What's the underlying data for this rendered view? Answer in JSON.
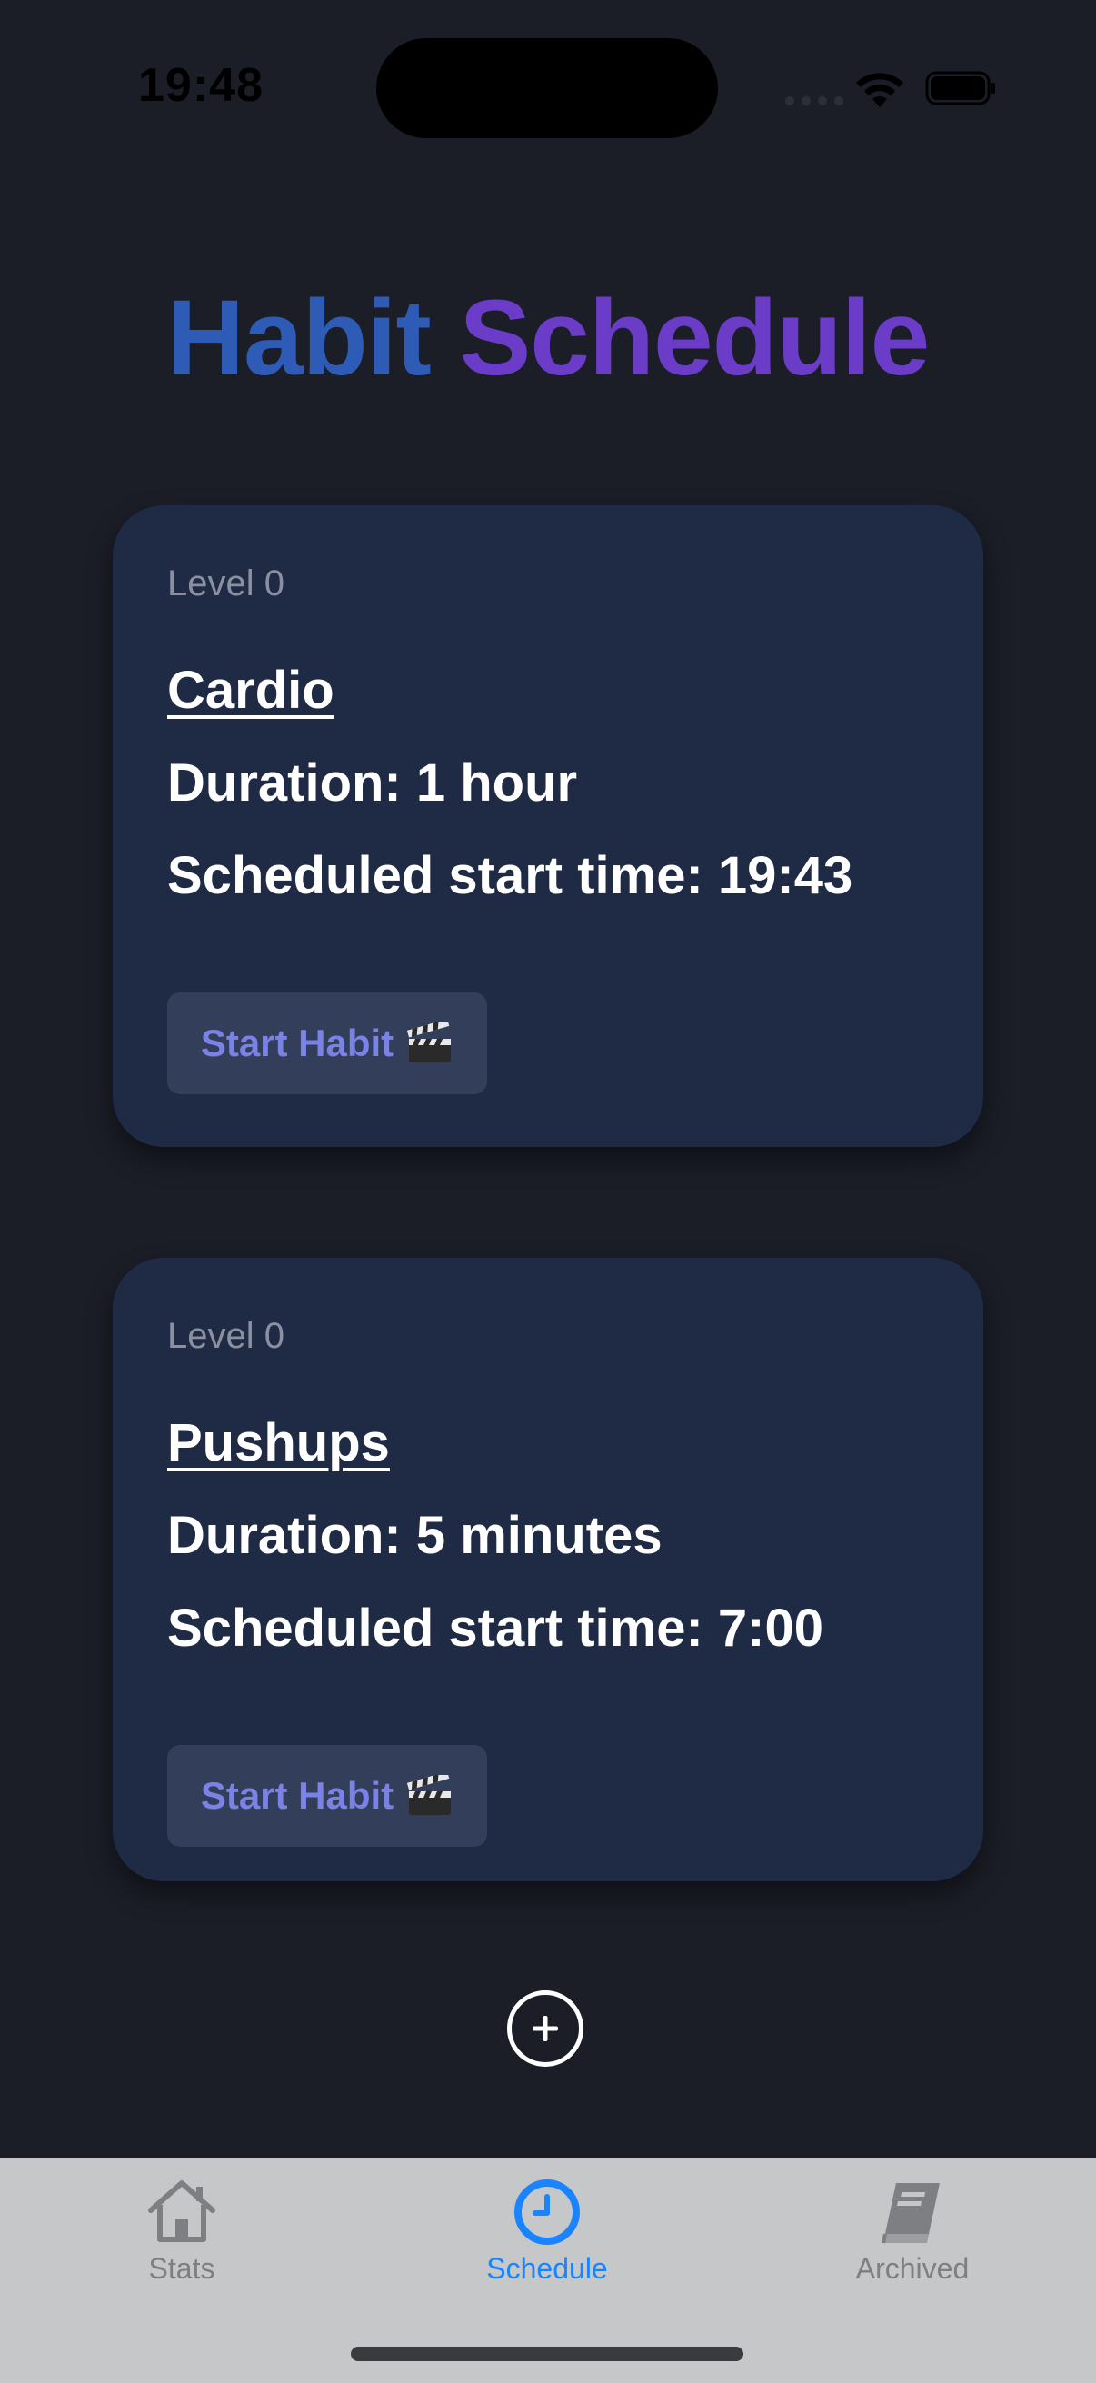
{
  "status_bar": {
    "time": "19:48"
  },
  "header": {
    "title_part1": "Habit",
    "title_part2": "Schedule"
  },
  "habits": [
    {
      "level": "Level 0",
      "name": "Cardio",
      "duration": "Duration: 1 hour",
      "start_time": "Scheduled start time: 19:43",
      "button_label": "Start Habit"
    },
    {
      "level": "Level 0",
      "name": "Pushups",
      "duration": "Duration: 5 minutes",
      "start_time": "Scheduled start time: 7:00",
      "button_label": "Start Habit"
    }
  ],
  "tab_bar": {
    "tabs": [
      {
        "label": "Stats",
        "icon": "house-icon",
        "active": false
      },
      {
        "label": "Schedule",
        "icon": "clock-icon",
        "active": true
      },
      {
        "label": "Archived",
        "icon": "book-icon",
        "active": false
      }
    ]
  },
  "colors": {
    "background": "#1b1e27",
    "card": "#1f2b45",
    "title_blue": "#2e5bb5",
    "title_purple": "#6a3cc7",
    "button_text": "#7a82e6",
    "tab_active": "#1a84ff",
    "tab_inactive": "#7d7f83"
  }
}
